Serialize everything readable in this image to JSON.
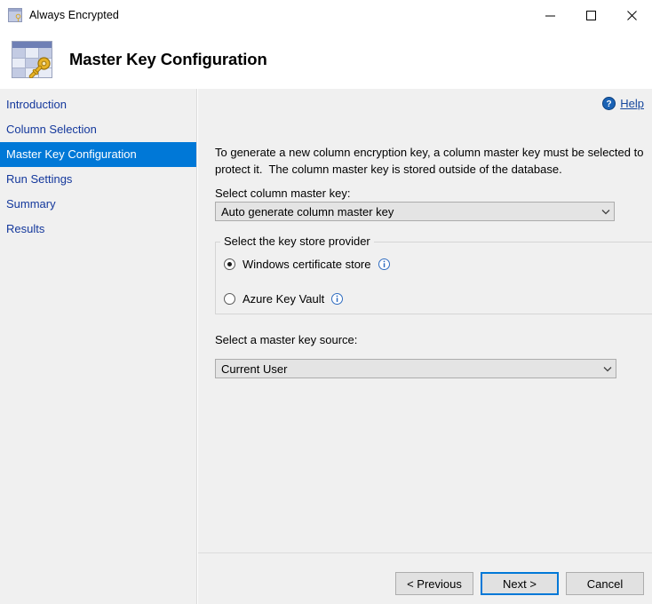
{
  "window": {
    "title": "Always Encrypted",
    "icon": "table-key-icon",
    "controls": {
      "minimize": "minimize-icon",
      "maximize": "maximize-icon",
      "close": "close-icon"
    }
  },
  "header": {
    "title": "Master Key Configuration",
    "icon": "table-key-icon"
  },
  "sidebar": {
    "items": [
      {
        "label": "Introduction",
        "active": false
      },
      {
        "label": "Column Selection",
        "active": false
      },
      {
        "label": "Master Key Configuration",
        "active": true
      },
      {
        "label": "Run Settings",
        "active": false
      },
      {
        "label": "Summary",
        "active": false
      },
      {
        "label": "Results",
        "active": false
      }
    ]
  },
  "content": {
    "help_label": "Help",
    "help_icon": "help-circle-icon",
    "description": "To generate a new column encryption key, a column master key must be selected to protect it.  The column master key is stored outside of the database.",
    "column_master_key": {
      "label": "Select column master key:",
      "value": "Auto generate column master key"
    },
    "key_store_provider": {
      "legend": "Select the key store provider",
      "options": [
        {
          "label": "Windows certificate store",
          "selected": true,
          "info_icon": "info-circle-icon"
        },
        {
          "label": "Azure Key Vault",
          "selected": false,
          "info_icon": "info-circle-icon"
        }
      ]
    },
    "master_key_source": {
      "label": "Select a master key source:",
      "value": "Current User"
    }
  },
  "footer": {
    "previous_label": "< Previous",
    "next_label": "Next >",
    "cancel_label": "Cancel"
  },
  "colors": {
    "accent": "#0078d7",
    "link": "#14389c",
    "panel": "#f0f0f0"
  }
}
